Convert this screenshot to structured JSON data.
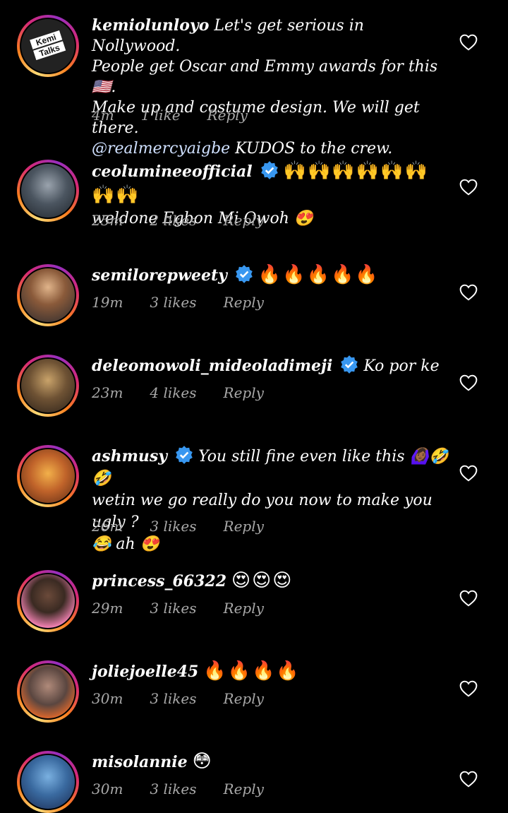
{
  "colors": {
    "background": "#000000",
    "text": "#ffffff",
    "meta": "#a8a8a8",
    "verified": "#3897f0",
    "mention": "#cfe0ff"
  },
  "reply_label": "Reply",
  "comments": [
    {
      "username": "kemiolunloyo",
      "verified": false,
      "text_lines": [
        "Let's get serious in Nollywood.",
        "People get Oscar and Emmy awards for this🇺🇸.",
        "Make up and costume design. We will get there."
      ],
      "mention": "@realmercyaigbe",
      "mention_tail": " KUDOS to the crew.",
      "time": "4m",
      "likes": "1 like"
    },
    {
      "username": "ceolumineeofficial",
      "verified": true,
      "emoji": "🙌🙌🙌🙌🙌🙌🙌🙌",
      "line2": "weldone Egbon Mi Owoh 😍",
      "time": "25m",
      "likes": "2 likes"
    },
    {
      "username": "semilorepweety",
      "verified": true,
      "emoji": "🔥🔥🔥🔥🔥",
      "time": "19m",
      "likes": "3 likes"
    },
    {
      "username": "deleomowoli_mideoladimeji",
      "verified": true,
      "text": "Ko por ke",
      "time": "23m",
      "likes": "4 likes"
    },
    {
      "username": "ashmusy",
      "verified": true,
      "text": "You still fine even like this 🙆🏾‍♀️🤣🤣",
      "line2": "wetin we go really do you now to make you ugly ?",
      "line3": "😂 ah 😍",
      "time": "26m",
      "likes": "3 likes"
    },
    {
      "username": "princess_66322",
      "verified": false,
      "emoji": "😍😍😍",
      "time": "29m",
      "likes": "3 likes"
    },
    {
      "username": "joliejoelle45",
      "verified": false,
      "emoji": "🔥🔥🔥🔥",
      "time": "30m",
      "likes": "3 likes"
    },
    {
      "username": "misolannie",
      "verified": false,
      "emoji": "😳",
      "time": "30m",
      "likes": "3 likes"
    }
  ],
  "kemi_logo": {
    "line1": "Kemi",
    "line2": "Talks"
  }
}
